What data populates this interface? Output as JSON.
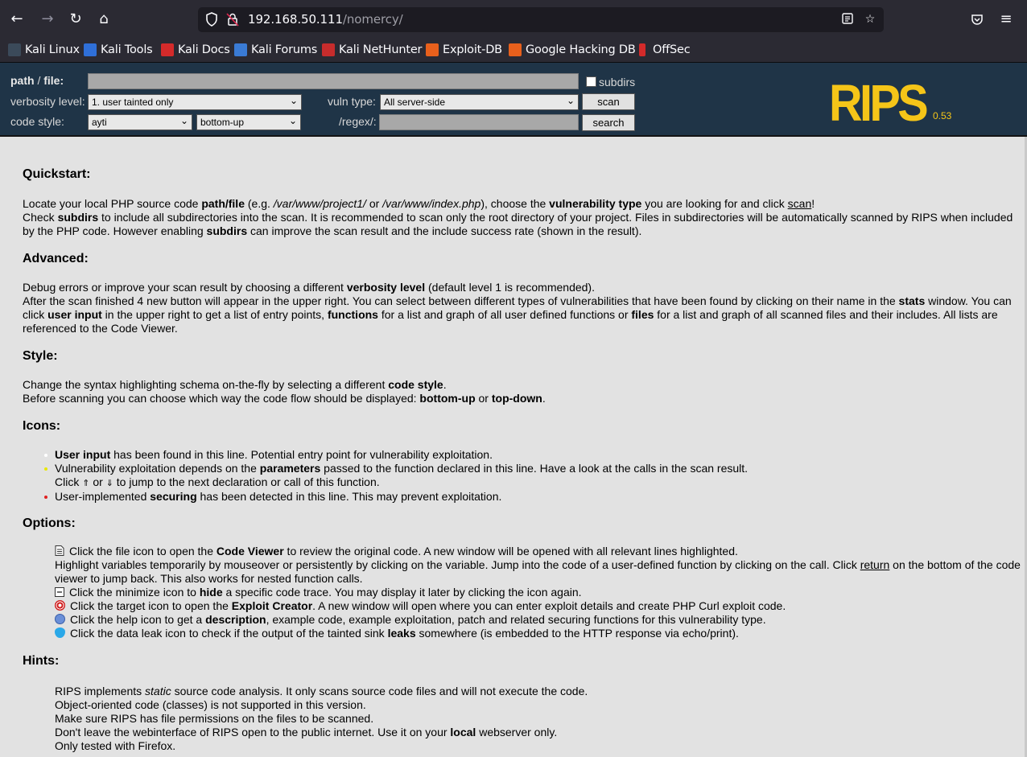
{
  "browser": {
    "url_host": "192.168.50.111",
    "url_path": "/nomercy/",
    "bookmarks": [
      "Kali Linux",
      "Kali Tools",
      "Kali Docs",
      "Kali Forums",
      "Kali NetHunter",
      "Exploit-DB",
      "Google Hacking DB",
      "OffSec"
    ]
  },
  "rips": {
    "path_label_a": "path",
    "path_label_b": " / ",
    "path_label_c": "file:",
    "path_value": "",
    "subdirs_label": "subdirs",
    "verbosity_label": "verbosity level:",
    "verbosity_value": "1. user tainted only",
    "vuln_label": "vuln type:",
    "vuln_value": "All server-side",
    "scan_button": "scan",
    "codestyle_label": "code style:",
    "codestyle_value": "ayti",
    "flow_value": "bottom-up",
    "regex_label": "/regex/:",
    "regex_value": "",
    "search_button": "search",
    "logo": "RIPS",
    "version": "0.53"
  },
  "content": {
    "quickstart_title": "Quickstart:",
    "advanced_title": "Advanced:",
    "style_title": "Style:",
    "icons_title": "Icons:",
    "options_title": "Options:",
    "hints_title": "Hints:",
    "hints": [
      "Object-oriented code (classes) is not supported in this version.",
      "Make sure RIPS has file permissions on the files to be scanned.",
      "Only tested with Firefox."
    ]
  },
  "colors": {
    "header_bg": "#1f3447",
    "logo": "#f5c518",
    "user_input_dot": "#ffffff",
    "parameters_dot": "#e8e800",
    "securing_dot": "#e02020"
  }
}
